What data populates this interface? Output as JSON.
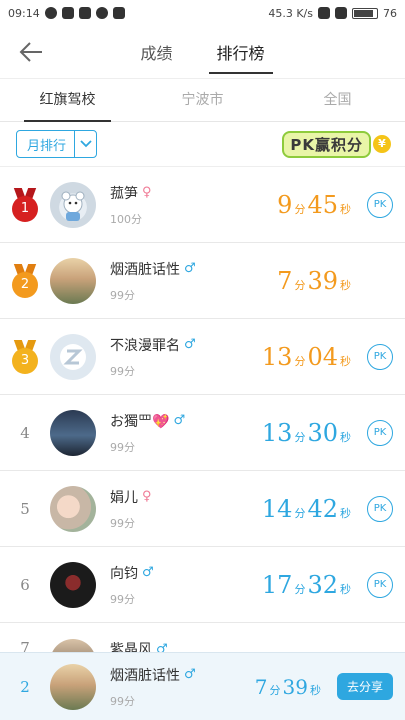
{
  "status_bar": {
    "time": "09:14",
    "network_speed": "45.3 K/s",
    "battery": "76"
  },
  "header": {
    "tabs": [
      {
        "label": "成绩",
        "active": false
      },
      {
        "label": "排行榜",
        "active": true
      }
    ]
  },
  "sub_tabs": [
    {
      "label": "红旗驾校",
      "active": true
    },
    {
      "label": "宁波市",
      "active": false
    },
    {
      "label": "全国",
      "active": false
    }
  ],
  "filter": {
    "selected": "月排行",
    "pk_banner": "PK赢积分"
  },
  "leaderboard": [
    {
      "rank": "1",
      "name": "菰笋",
      "gender": "female",
      "score": "100分",
      "time_min": "9",
      "time_sec": "45",
      "pk": true
    },
    {
      "rank": "2",
      "name": "烟酒脏话性",
      "gender": "male",
      "score": "99分",
      "time_min": "7",
      "time_sec": "39",
      "pk": false
    },
    {
      "rank": "3",
      "name": "不浪漫罪名",
      "gender": "male",
      "score": "99分",
      "time_min": "13",
      "time_sec": "04",
      "pk": true
    },
    {
      "rank": "4",
      "name": "お獨罒💖",
      "gender": "male",
      "score": "99分",
      "time_min": "13",
      "time_sec": "30",
      "pk": true
    },
    {
      "rank": "5",
      "name": "娟儿",
      "gender": "female",
      "score": "99分",
      "time_min": "14",
      "time_sec": "42",
      "pk": true
    },
    {
      "rank": "6",
      "name": "向钧",
      "gender": "male",
      "score": "99分",
      "time_min": "17",
      "time_sec": "32",
      "pk": true
    },
    {
      "rank": "7",
      "name": "紫晶风",
      "gender": "male",
      "score": "",
      "time_min": "",
      "time_sec": "",
      "pk": false
    }
  ],
  "labels": {
    "min_unit": "分",
    "sec_unit": "秒",
    "pk": "PK",
    "male_symbol": "♂",
    "female_symbol": "♀"
  },
  "my_rank": {
    "rank": "2",
    "name": "烟酒脏话性",
    "score": "99分",
    "time_min": "7",
    "time_sec": "39",
    "share_label": "去分享"
  },
  "colors": {
    "accent": "#2ea7e0",
    "top_time": "#f39a1e",
    "gold": "#d62020",
    "silver": "#f39a1e",
    "bronze": "#f3b21e"
  }
}
